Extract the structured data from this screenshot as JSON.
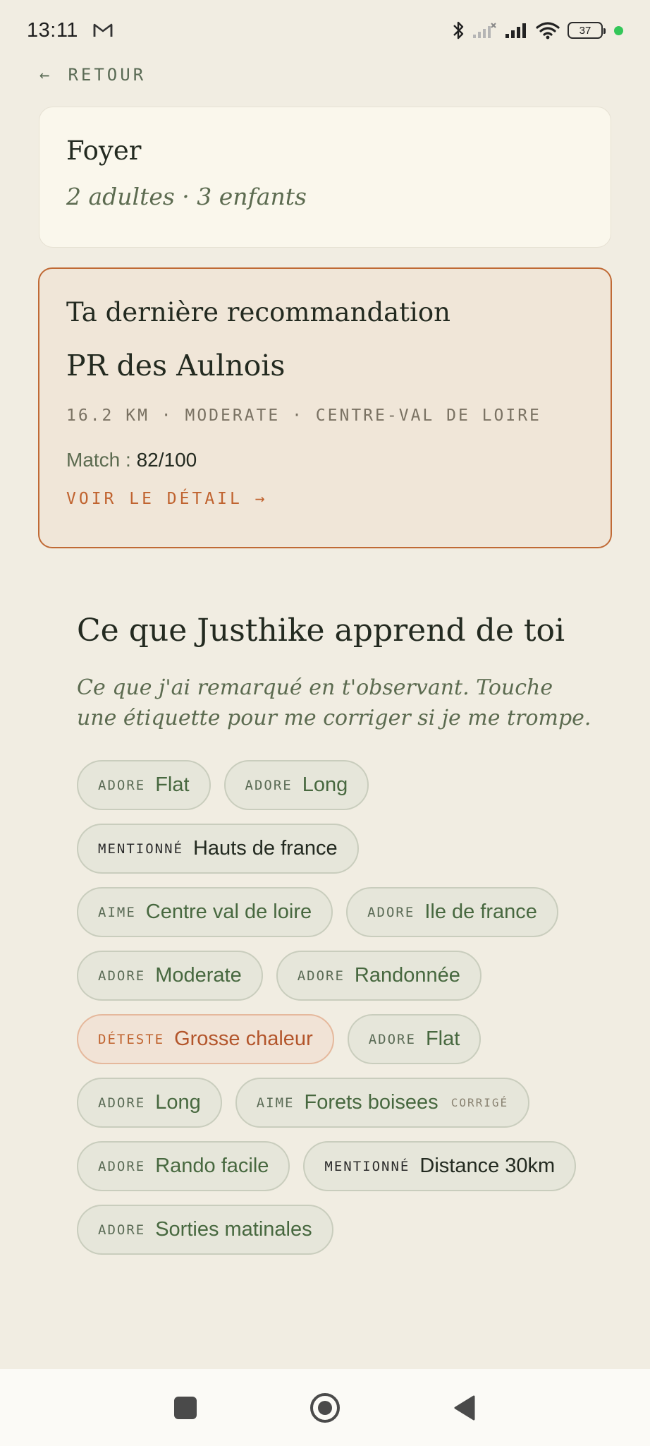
{
  "status_bar": {
    "time": "13:11",
    "battery": "37",
    "icons": [
      "gmail-icon",
      "bluetooth-icon",
      "signal-off-icon",
      "signal-icon",
      "wifi-icon",
      "battery-icon"
    ]
  },
  "back": {
    "arrow": "←",
    "label": "RETOUR"
  },
  "household": {
    "title": "Foyer",
    "summary": "2 adultes · 3 enfants"
  },
  "recommendation": {
    "heading": "Ta dernière recommandation",
    "name": "PR des Aulnois",
    "meta": "16.2 KM · MODERATE · CENTRE-VAL DE LOIRE",
    "match_label": "Match : ",
    "match_value": "82/100",
    "link_label": "VOIR LE DÉTAIL →"
  },
  "learning": {
    "title": "Ce que Justhike apprend de toi",
    "subtitle": "Ce que j'ai remarqué en t'observant. Touche une étiquette pour me corriger si je me trompe.",
    "tags": [
      {
        "kind": "ADORE",
        "value": "Flat"
      },
      {
        "kind": "ADORE",
        "value": "Long"
      },
      {
        "kind": "MENTIONNÉ",
        "value": "Hauts de france"
      },
      {
        "kind": "AIME",
        "value": "Centre val de loire"
      },
      {
        "kind": "ADORE",
        "value": "Ile de france"
      },
      {
        "kind": "ADORE",
        "value": "Moderate"
      },
      {
        "kind": "ADORE",
        "value": "Randonnée"
      },
      {
        "kind": "DÉTESTE",
        "value": "Grosse chaleur"
      },
      {
        "kind": "ADORE",
        "value": "Flat"
      },
      {
        "kind": "ADORE",
        "value": "Long"
      },
      {
        "kind": "AIME",
        "value": "Forets boisees",
        "note": "CORRIGÉ"
      },
      {
        "kind": "ADORE",
        "value": "Rando facile"
      },
      {
        "kind": "MENTIONNÉ",
        "value": "Distance 30km"
      },
      {
        "kind": "ADORE",
        "value": "Sorties matinales"
      }
    ]
  },
  "colors": {
    "background": "#f1ede2",
    "accent_orange": "#c0632f",
    "green_text": "#47683f"
  }
}
